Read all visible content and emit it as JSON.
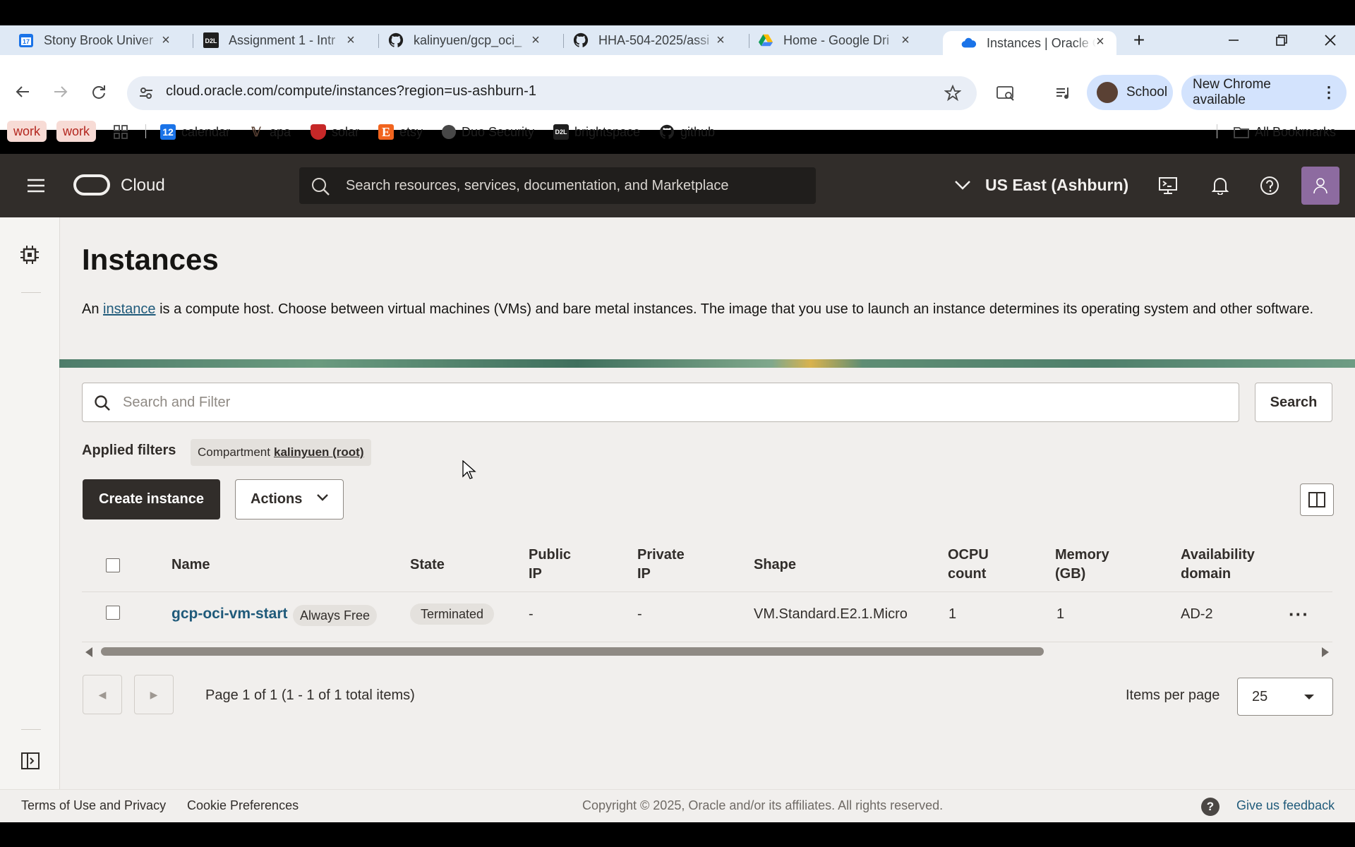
{
  "browser": {
    "tabs": [
      {
        "title": "Stony Brook Univer",
        "icon": "calendar-17-icon"
      },
      {
        "title": "Assignment 1 - Intr",
        "icon": "d2l-icon"
      },
      {
        "title": "kalinyuen/gcp_oci_",
        "icon": "github-icon"
      },
      {
        "title": "HHA-504-2025/assi",
        "icon": "github-icon"
      },
      {
        "title": "Home - Google Dri",
        "icon": "google-drive-icon"
      },
      {
        "title": "Instances | Oracle C",
        "icon": "oracle-cloud-icon",
        "active": true
      }
    ],
    "url": "cloud.oracle.com/compute/instances?region=us-ashburn-1",
    "profile_label": "School",
    "update_label": "New Chrome available",
    "bookmarks": {
      "work1": "work",
      "work2": "work",
      "calendar": "calendar",
      "apa": "apa",
      "solar": "solar",
      "etsy": "etsy",
      "duo": "Duo Security",
      "brightspace": "brightspace",
      "github": "github",
      "all": "All Bookmarks"
    }
  },
  "oci": {
    "logo_text": "Cloud",
    "search_placeholder": "Search resources, services, documentation, and Marketplace",
    "region": "US East (Ashburn)"
  },
  "page": {
    "title": "Instances",
    "intro_prefix": "An ",
    "intro_link": "instance",
    "intro_rest": " is a compute host. Choose between virtual machines (VMs) and bare metal instances. The image that you use to launch an instance determines its operating system and other software.",
    "filter_placeholder": "Search and Filter",
    "search_button": "Search",
    "applied_filters_label": "Applied filters",
    "chip_label": "Compartment",
    "chip_value": "kalinyuen (root)",
    "create_button": "Create instance",
    "actions_button": "Actions"
  },
  "table": {
    "headers": {
      "name": "Name",
      "state": "State",
      "public_ip_1": "Public",
      "public_ip_2": "IP",
      "private_ip_1": "Private",
      "private_ip_2": "IP",
      "shape": "Shape",
      "ocpu_1": "OCPU",
      "ocpu_2": "count",
      "memory_1": "Memory",
      "memory_2": "(GB)",
      "ad_1": "Availability",
      "ad_2": "domain"
    },
    "rows": [
      {
        "name": "gcp-oci-vm-start",
        "badge": "Always Free",
        "state": "Terminated",
        "public_ip": "-",
        "private_ip": "-",
        "shape": "VM.Standard.E2.1.Micro",
        "ocpu": "1",
        "memory": "1",
        "ad": "AD-2"
      }
    ]
  },
  "pagination": {
    "info": "Page 1 of 1 (1 - 1 of 1 total items)",
    "items_per_page_label": "Items per page",
    "items_per_page": "25"
  },
  "footer": {
    "terms": "Terms of Use and Privacy",
    "cookies": "Cookie Preferences",
    "copyright": "Copyright © 2025, Oracle and/or its affiliates. All rights reserved.",
    "feedback": "Give us feedback"
  }
}
